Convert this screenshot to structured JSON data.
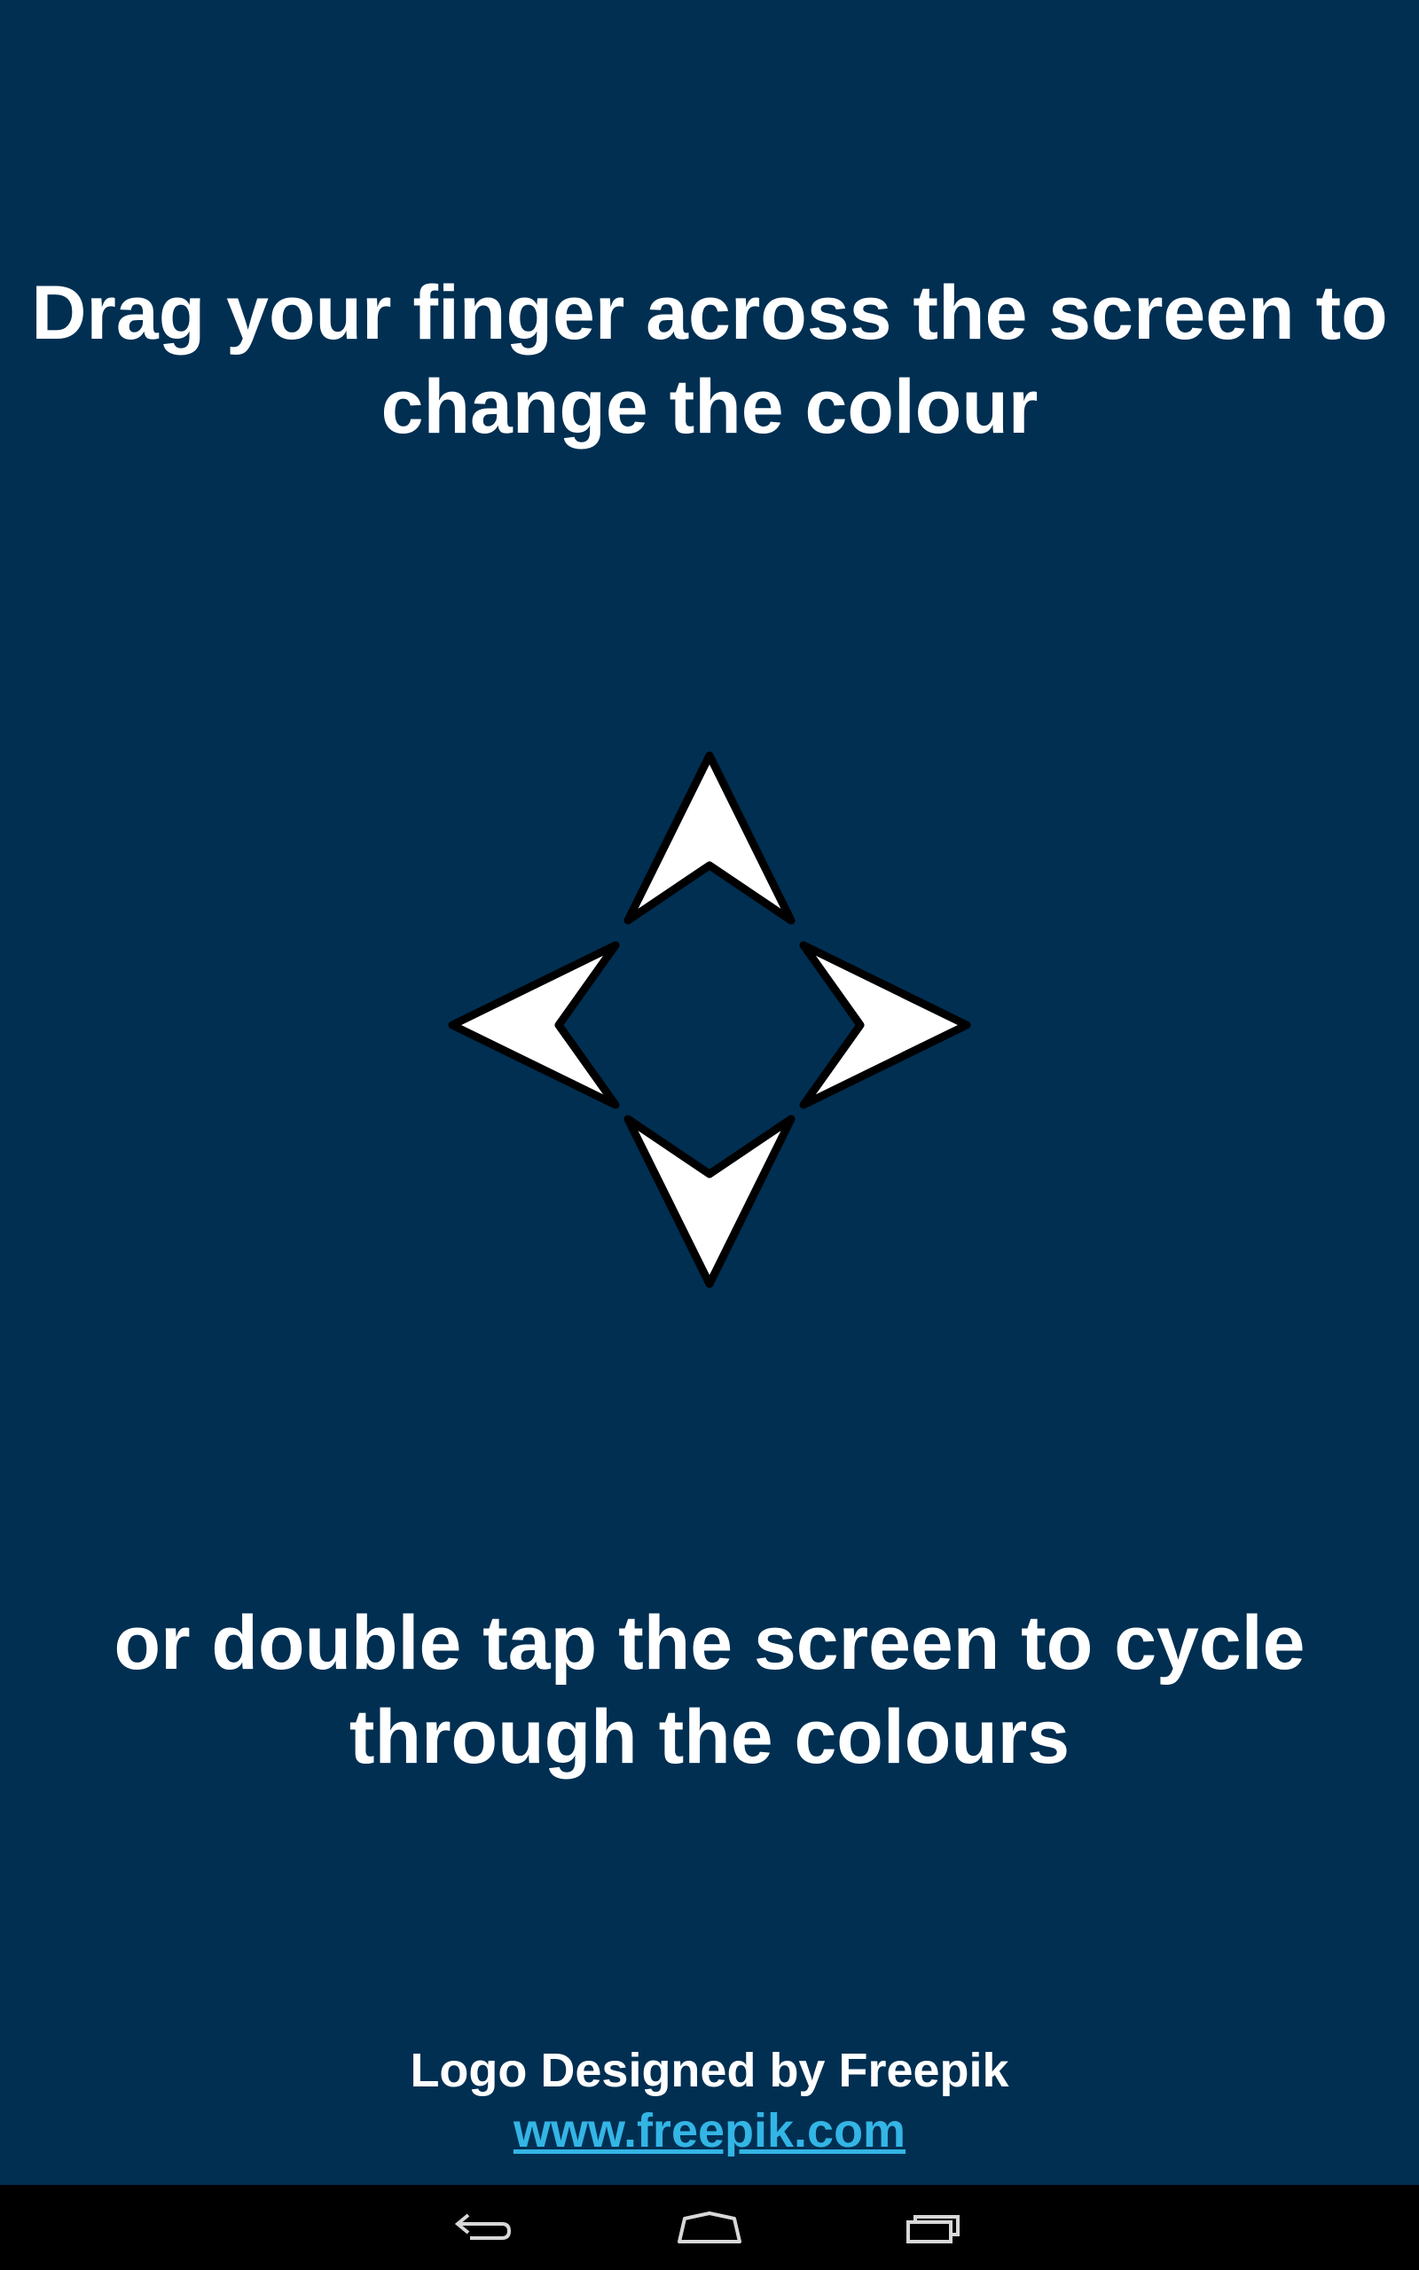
{
  "instructions": {
    "top_line1": "Drag your finger across the screen to",
    "top_line2": "change the colour",
    "bottom_line1": "or double tap the screen to cycle",
    "bottom_line2": "through the colours"
  },
  "logo": {
    "icon": "four-direction-arrows-icon"
  },
  "credit": {
    "text": "Logo Designed by Freepik",
    "link_text": "www.freepik.com"
  },
  "navbar": {
    "back_icon": "back-icon",
    "home_icon": "home-icon",
    "recent_icon": "recent-apps-icon"
  },
  "colors": {
    "background": "#002f52",
    "text": "#ffffff",
    "link": "#33b5e5",
    "navbar": "#000000"
  }
}
